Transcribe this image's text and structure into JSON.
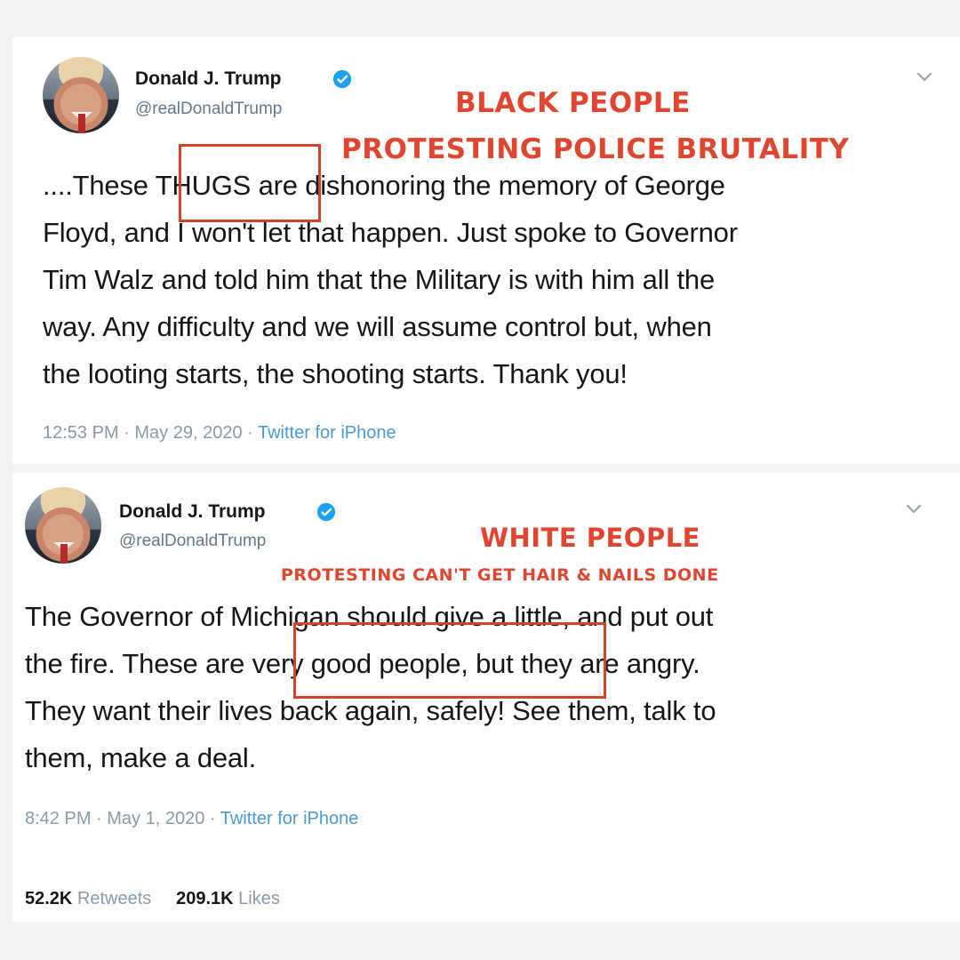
{
  "tweets": [
    {
      "author_name": "Donald J. Trump",
      "handle": "@realDonaldTrump",
      "annotation_main": "BLACK PEOPLE",
      "annotation_sub": "PROTESTING POLICE BRUTALITY",
      "boxed_phrase": "THUGS",
      "text_lines": [
        "....These THUGS are dishonoring the memory of George",
        "Floyd, and I won't let that happen. Just spoke to Governor",
        "Tim Walz and told him that the Military is with him all the",
        "way. Any difficulty and we will assume control but, when",
        "the looting starts, the shooting starts. Thank you!"
      ],
      "timestamp": "12:53 PM · May 29, 2020 · ",
      "source": "Twitter for iPhone"
    },
    {
      "author_name": "Donald J. Trump",
      "handle": "@realDonaldTrump",
      "annotation_main": "WHITE PEOPLE",
      "annotation_sub": "PROTESTING CAN'T GET HAIR & NAILS DONE",
      "boxed_phrase": "very good people,",
      "text_lines": [
        "The Governor of Michigan should give a little, and put out",
        "the fire. These are very good people, but they are angry.",
        "They want their lives back again, safely! See them, talk to",
        "them, make a deal."
      ],
      "timestamp": "8:42 PM · May 1, 2020 · ",
      "source": "Twitter for iPhone",
      "retweets_count": "52.2K",
      "retweets_label": "Retweets",
      "likes_count": "209.1K",
      "likes_label": "Likes"
    }
  ],
  "colors": {
    "annotation": "#e0452f",
    "verified": "#1da1f2",
    "link": "#4a98d6"
  },
  "icons": [
    "verified-badge-icon",
    "chevron-down-icon",
    "avatar"
  ]
}
